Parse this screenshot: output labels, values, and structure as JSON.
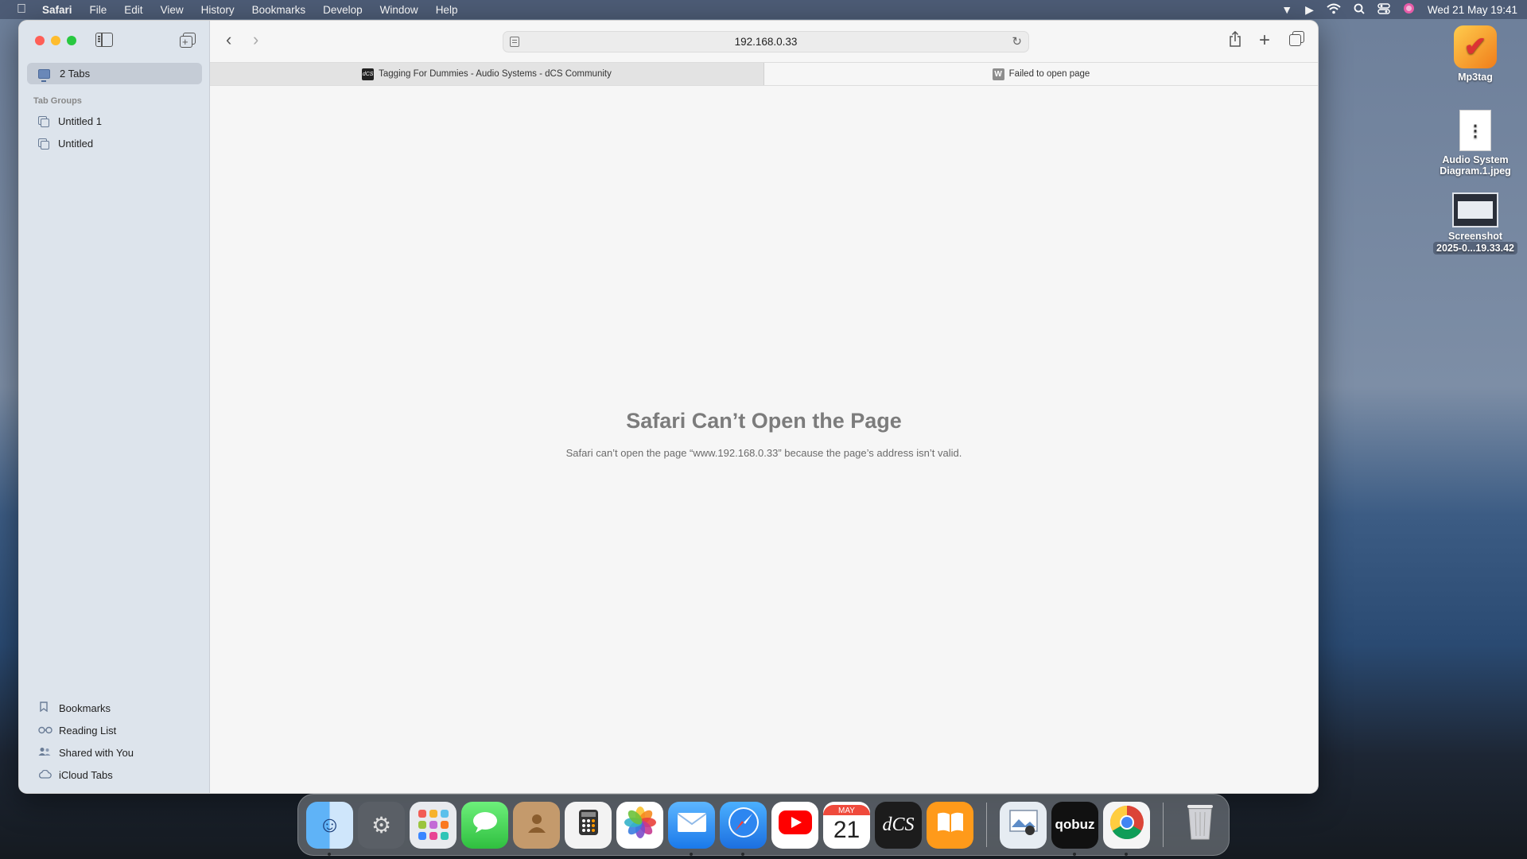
{
  "menubar": {
    "apple": "",
    "items": [
      "Safari",
      "File",
      "Edit",
      "View",
      "History",
      "Bookmarks",
      "Develop",
      "Window",
      "Help"
    ],
    "datetime": "Wed 21 May  19:41",
    "status_icons": [
      "airpods-icon",
      "play-icon",
      "wifi-icon",
      "search-icon",
      "control-center-icon",
      "siri-icon"
    ]
  },
  "desktop": {
    "icons": [
      {
        "name": "Mp3tag",
        "line2": ""
      },
      {
        "name": "Audio System",
        "line2": "Diagram.1.jpeg"
      },
      {
        "name": "Screenshot",
        "line2": "2025-0...19.33.42"
      }
    ]
  },
  "sidebar": {
    "tabs_label": "2 Tabs",
    "tab_groups_heading": "Tab Groups",
    "groups": [
      "Untitled 1",
      "Untitled"
    ],
    "bottom_items": [
      "Bookmarks",
      "Reading List",
      "Shared with You",
      "iCloud Tabs"
    ]
  },
  "toolbar": {
    "address": "192.168.0.33"
  },
  "tabs": [
    {
      "title": "Tagging For Dummies - Audio Systems - dCS Community",
      "favicon": "dCS",
      "active": false
    },
    {
      "title": "Failed to open page",
      "favicon": "W",
      "active": true
    }
  ],
  "error": {
    "title": "Safari Can’t Open the Page",
    "message": "Safari can’t open the page “www.192.168.0.33” because the page’s address isn’t valid."
  },
  "dock": {
    "calendar_month": "MAY",
    "calendar_day": "21",
    "dcs_label": "dCS",
    "qobuz_label": "qobuz",
    "apps": [
      "Finder",
      "System Settings",
      "Launchpad",
      "Messages",
      "Contacts",
      "Calculator",
      "Photos",
      "Mail",
      "Safari",
      "YouTube",
      "Calendar",
      "dCS",
      "Books",
      "Preview",
      "Qobuz",
      "Chrome",
      "Trash"
    ]
  },
  "colors": {
    "close": "#fe5f57",
    "minimize": "#febc2e",
    "zoom": "#28c840",
    "sidebar_bg": "#dde4ec",
    "error_title": "#7c7c7c"
  }
}
